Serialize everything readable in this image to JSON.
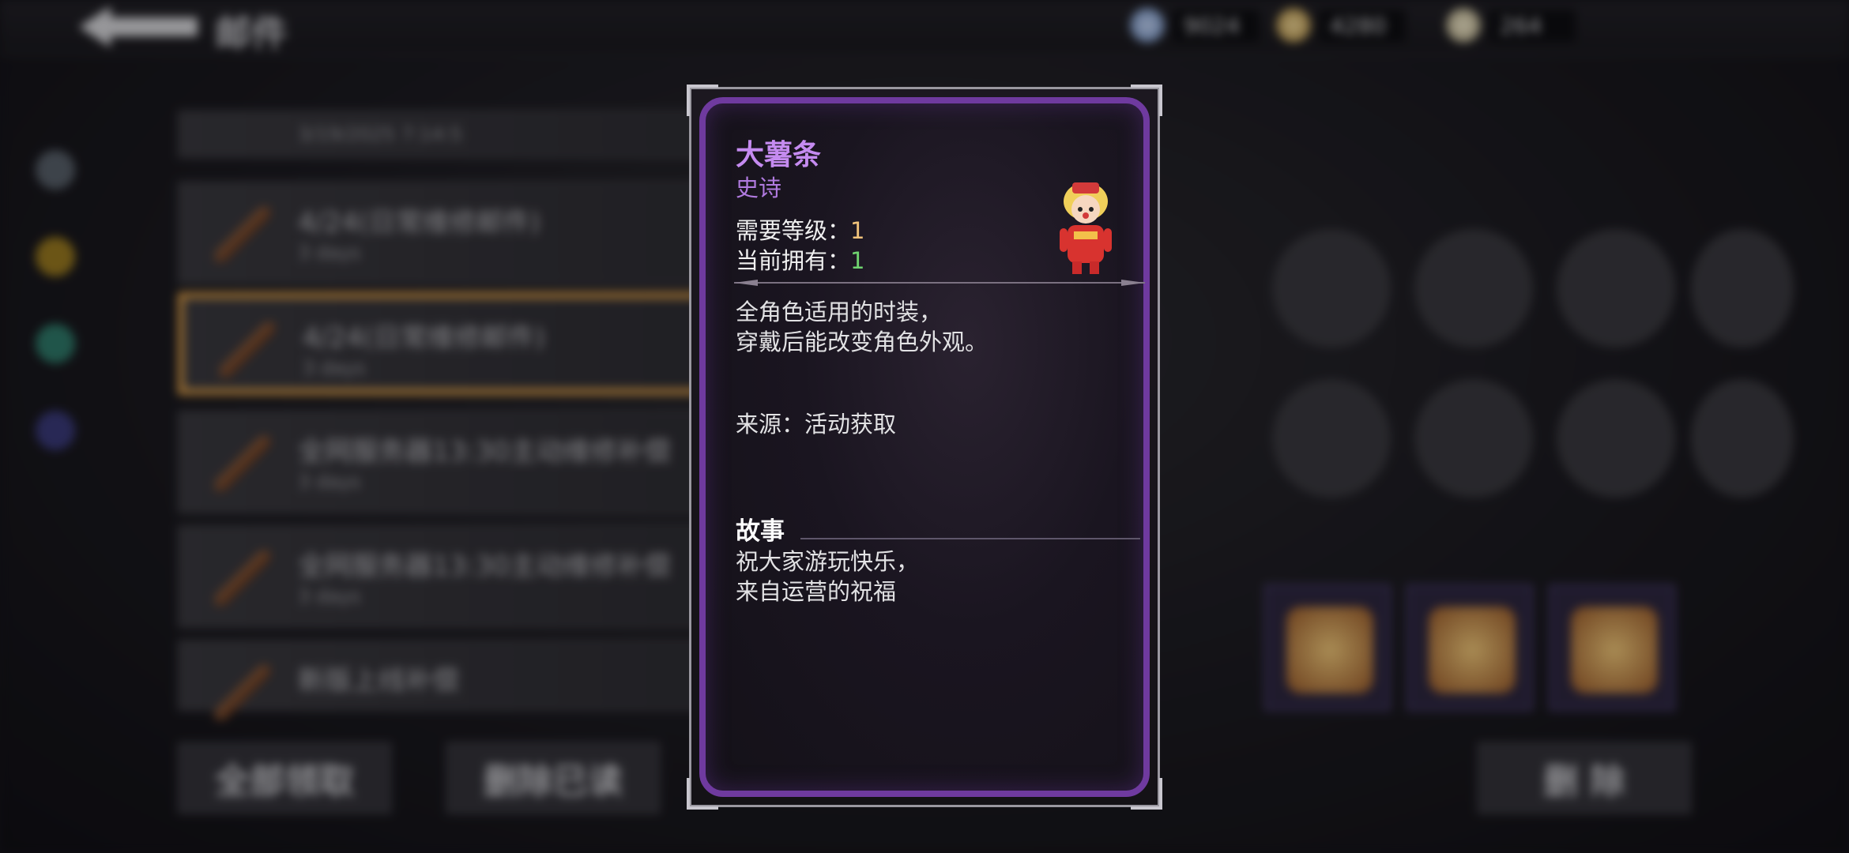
{
  "topbar": {
    "title": "邮件",
    "currencies": [
      {
        "icon": "crystal-icon",
        "amount": "9024",
        "color": "#7fa9e0"
      },
      {
        "icon": "gold-ore-icon",
        "amount": "4280",
        "color": "#d6b46a"
      },
      {
        "icon": "feather-icon",
        "amount": "264",
        "color": "#d8d0b0"
      }
    ]
  },
  "mail_list": [
    {
      "title": "",
      "subtitle": "3/19/2025 7:14:5"
    },
    {
      "title": "4/24(日常维修邮件)",
      "subtitle": "3 days"
    },
    {
      "title": "4/24(日常维修邮件)",
      "subtitle": "3 days"
    },
    {
      "title": "全网服务器13:30主动维修补偿",
      "subtitle": "3 days"
    },
    {
      "title": "全网服务器13:30主动维修补偿",
      "subtitle": "3 days"
    },
    {
      "title": "新版上线补偿",
      "subtitle": "3 days"
    }
  ],
  "bottom_buttons": {
    "claim_all": "全部领取",
    "delete_read": "删除已读",
    "delete": "删 除"
  },
  "card": {
    "name": "大薯条",
    "rarity": "史诗",
    "level_label": "需要等级：",
    "level_value": "1",
    "owned_label": "当前拥有：",
    "owned_value": "1",
    "desc_line1": "全角色适用的时装，",
    "desc_line2": "穿戴后能改变角色外观。",
    "source": "来源：活动获取",
    "story_title": "故事",
    "story_line1": "祝大家游玩快乐，",
    "story_line2": "来自运营的祝福",
    "name_color": "#c58bf0",
    "frame_color": "#6f3a9f"
  }
}
